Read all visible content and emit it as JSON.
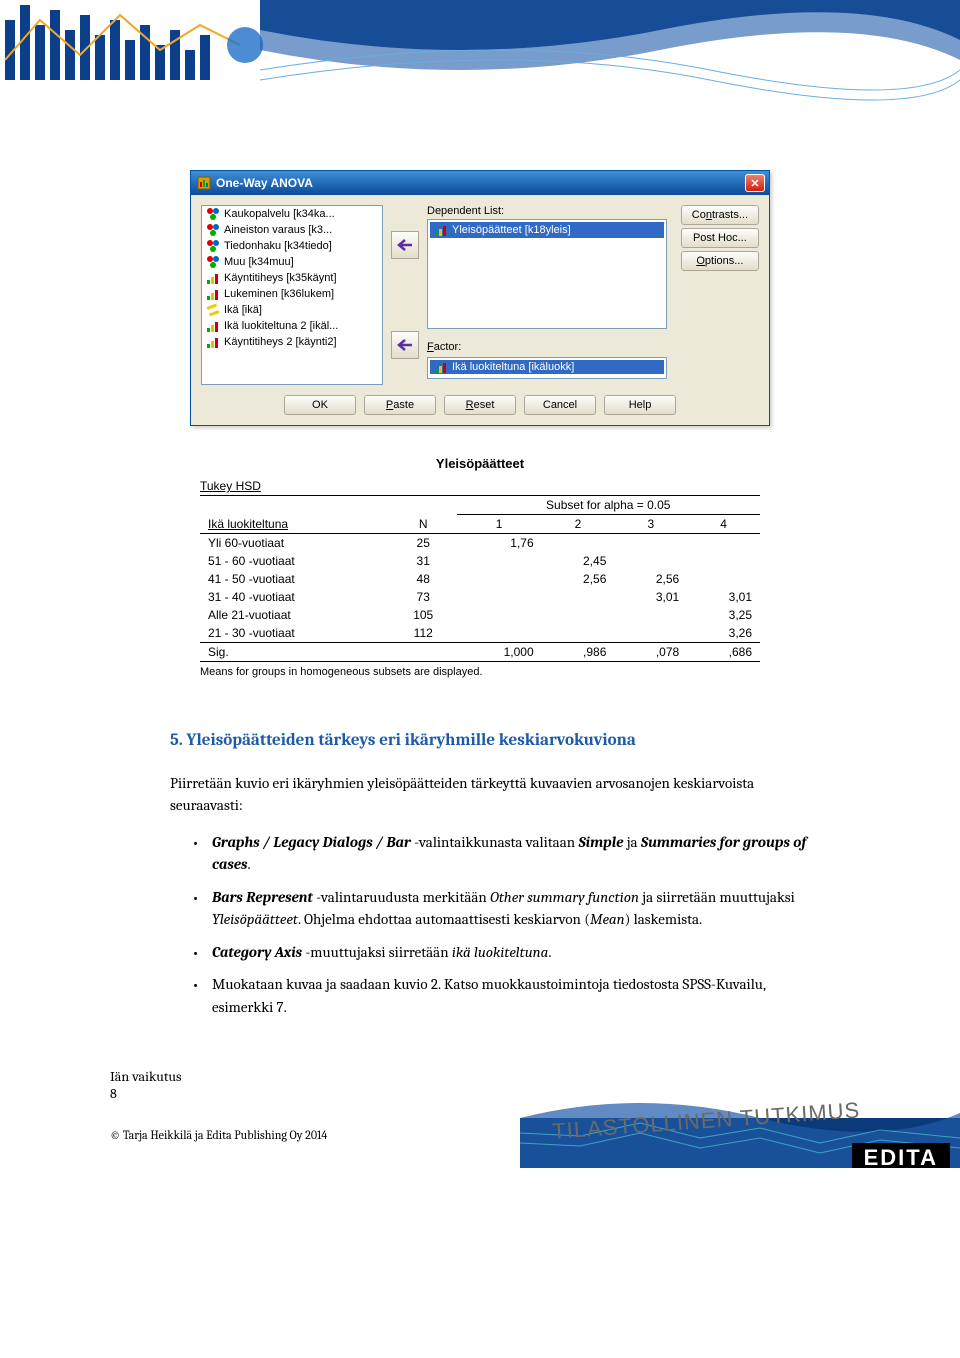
{
  "dialog": {
    "title": "One-Way ANOVA",
    "variables": [
      {
        "icon": "nominal",
        "label": "Kaukopalvelu [k34ka..."
      },
      {
        "icon": "nominal",
        "label": "Aineiston varaus [k3..."
      },
      {
        "icon": "nominal",
        "label": "Tiedonhaku [k34tiedo]"
      },
      {
        "icon": "nominal",
        "label": "Muu [k34muu]"
      },
      {
        "icon": "ordinal",
        "label": "Käyntitiheys [k35käynt]"
      },
      {
        "icon": "ordinal",
        "label": "Lukeminen [k36lukem]"
      },
      {
        "icon": "scale",
        "label": "Ikä [ikä]"
      },
      {
        "icon": "ordinal",
        "label": "Ikä luokiteltuna 2 [ikäl..."
      },
      {
        "icon": "ordinal",
        "label": "Käyntitiheys 2 [käynti2]"
      }
    ],
    "dependent_label": "Dependent List:",
    "dependent_item": "Yleisöpäätteet [k18yleis]",
    "factor_label": "Factor:",
    "factor_item": "Ikä luokiteltuna [ikäluokk]",
    "side_buttons": {
      "contrasts": "Contrasts...",
      "posthoc": "Post Hoc...",
      "options": "Options..."
    },
    "bottom": {
      "ok": "OK",
      "paste": "Paste",
      "reset": "Reset",
      "cancel": "Cancel",
      "help": "Help"
    }
  },
  "output": {
    "title": "Yleisöpäätteet",
    "method": "Tukey HSD",
    "subset_header": "Subset for alpha = 0.05",
    "group_col": "Ikä luokiteltuna",
    "n_col": "N",
    "cols": [
      "1",
      "2",
      "3",
      "4"
    ],
    "rows": [
      {
        "label": "Yli 60-vuotiaat",
        "n": "25",
        "v": [
          "1,76",
          "",
          "",
          ""
        ]
      },
      {
        "label": "51 - 60 -vuotiaat",
        "n": "31",
        "v": [
          "",
          "2,45",
          "",
          ""
        ]
      },
      {
        "label": "41 - 50 -vuotiaat",
        "n": "48",
        "v": [
          "",
          "2,56",
          "2,56",
          ""
        ]
      },
      {
        "label": "31 - 40 -vuotiaat",
        "n": "73",
        "v": [
          "",
          "",
          "3,01",
          "3,01"
        ]
      },
      {
        "label": "Alle 21-vuotiaat",
        "n": "105",
        "v": [
          "",
          "",
          "",
          "3,25"
        ]
      },
      {
        "label": "21 - 30 -vuotiaat",
        "n": "112",
        "v": [
          "",
          "",
          "",
          "3,26"
        ]
      }
    ],
    "sig_label": "Sig.",
    "sig": [
      "1,000",
      ",986",
      ",078",
      ",686"
    ],
    "note": "Means for groups in homogeneous subsets are displayed."
  },
  "body": {
    "heading": "5. Yleisöpäätteiden tärkeys eri ikäryhmille keskiarvokuviona",
    "intro": "Piirretään kuvio eri ikäryhmien yleisöpäätteiden tärkeyttä kuvaavien arvosanojen keskiarvoista seuraavasti:",
    "b1_a": "Graphs / Legacy Dialogs / Bar",
    "b1_b": " -valintaikkunasta valitaan ",
    "b1_c": "Simple",
    "b1_d": " ja ",
    "b1_e": "Summaries for groups of cases",
    "b1_f": ".",
    "b2_a": "Bars Represent",
    "b2_b": " -valintaruudusta merkitään ",
    "b2_c": "Other summary function",
    "b2_d": " ja siirretään muuttujaksi ",
    "b2_e": "Yleisöpäätteet",
    "b2_f": ". Ohjelma ehdottaa automaattisesti keskiarvon (",
    "b2_g": "Mean",
    "b2_h": ") laskemista.",
    "b3_a": "Category Axis",
    "b3_b": " -muuttujaksi siirretään ",
    "b3_c": "ikä luokiteltuna",
    "b3_d": ".",
    "b4": "Muokataan kuvaa ja saadaan kuvio 2. Katso muokkaustoimintoja tiedostosta SPSS-Kuvailu, esimerkki 7."
  },
  "footer": {
    "label": "Iän vaikutus",
    "page": "8",
    "copy": "© Tarja Heikkilä ja Edita Publishing Oy 2014",
    "tilasto": "TILASTOLLINEN TUTKIMUS",
    "edita": "EDITA"
  },
  "chart_data": {
    "type": "table",
    "title": "Yleisöpäätteet — Tukey HSD homogeneous subsets (alpha = 0.05)",
    "columns": [
      "Ikä luokiteltuna",
      "N",
      "Subset 1",
      "Subset 2",
      "Subset 3",
      "Subset 4"
    ],
    "rows": [
      [
        "Yli 60-vuotiaat",
        25,
        1.76,
        null,
        null,
        null
      ],
      [
        "51 - 60 -vuotiaat",
        31,
        null,
        2.45,
        null,
        null
      ],
      [
        "41 - 50 -vuotiaat",
        48,
        null,
        2.56,
        2.56,
        null
      ],
      [
        "31 - 40 -vuotiaat",
        73,
        null,
        null,
        3.01,
        3.01
      ],
      [
        "Alle 21-vuotiaat",
        105,
        null,
        null,
        null,
        3.25
      ],
      [
        "21 - 30 -vuotiaat",
        112,
        null,
        null,
        null,
        3.26
      ],
      [
        "Sig.",
        null,
        1.0,
        0.986,
        0.078,
        0.686
      ]
    ]
  }
}
